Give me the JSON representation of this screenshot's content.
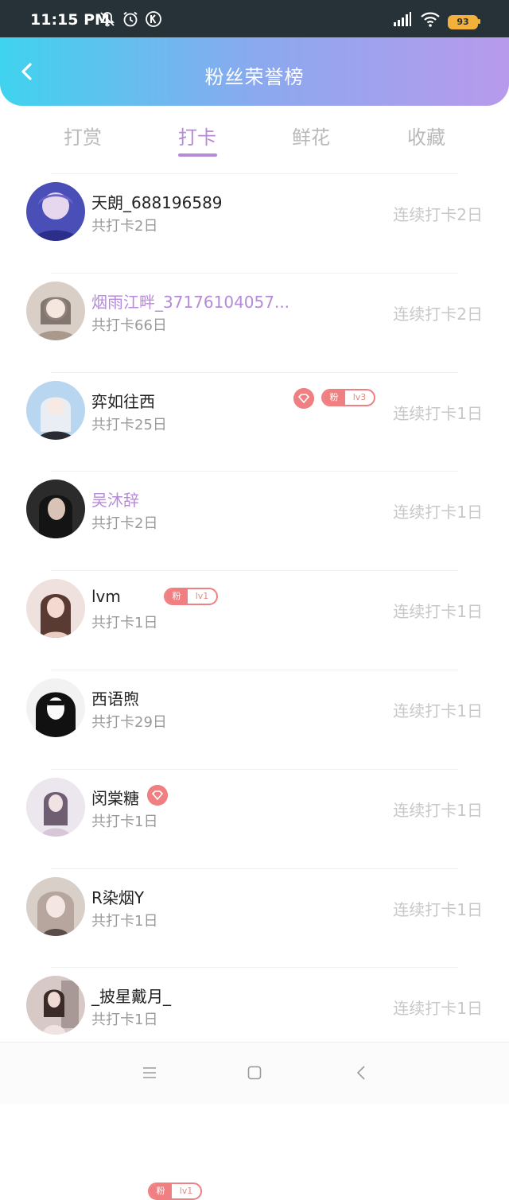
{
  "status_bar": {
    "time": "11:15 PM",
    "battery": "93",
    "icons": [
      "mute-bell-icon",
      "alarm-icon",
      "k-icon",
      "signal-icon",
      "wifi-icon",
      "battery-icon"
    ]
  },
  "header": {
    "title": "粉丝荣誉榜",
    "back_icon": "chevron-left-icon",
    "gradient": [
      "#3fd3ee",
      "#b89aec"
    ]
  },
  "tabs": [
    {
      "label": "打赏",
      "active": false
    },
    {
      "label": "打卡",
      "active": true
    },
    {
      "label": "鲜花",
      "active": false
    },
    {
      "label": "收藏",
      "active": false
    }
  ],
  "accent_color": "#b58ad8",
  "badge_color": "#ef7f81",
  "rows": [
    {
      "name": "天朗_688196589",
      "total": "共打卡2日",
      "streak": "连续打卡2日",
      "vip": false,
      "fan": null
    },
    {
      "name": "烟雨江畔_37176104057...",
      "total": "共打卡66日",
      "streak": "连续打卡2日",
      "vip": true,
      "fan": {
        "label": "粉",
        "level": "lv3"
      }
    },
    {
      "name": "弈如往西",
      "total": "共打卡25日",
      "streak": "连续打卡1日",
      "vip": false,
      "fan": {
        "label": "粉",
        "level": "lv1"
      }
    },
    {
      "name": "吴沐辞",
      "total": "共打卡2日",
      "streak": "连续打卡1日",
      "vip": true,
      "fan": null
    },
    {
      "name": "lvm",
      "total": "共打卡1日",
      "streak": "连续打卡1日",
      "vip": false,
      "fan": null
    },
    {
      "name": "西语煦",
      "total": "共打卡29日",
      "streak": "连续打卡1日",
      "vip": false,
      "fan": {
        "label": "粉",
        "level": "lv1"
      }
    },
    {
      "name": "闵棠糖",
      "total": "共打卡1日",
      "streak": "连续打卡1日",
      "vip": false,
      "fan": null
    },
    {
      "name": "R染烟Y",
      "total": "共打卡1日",
      "streak": "连续打卡1日",
      "vip": false,
      "fan": null
    },
    {
      "name": "_披星戴月_",
      "total": "共打卡1日",
      "streak": "连续打卡1日",
      "vip": false,
      "fan": null
    }
  ],
  "bottom_nav": [
    "menu-icon",
    "home-square-icon",
    "back-triangle-icon"
  ]
}
